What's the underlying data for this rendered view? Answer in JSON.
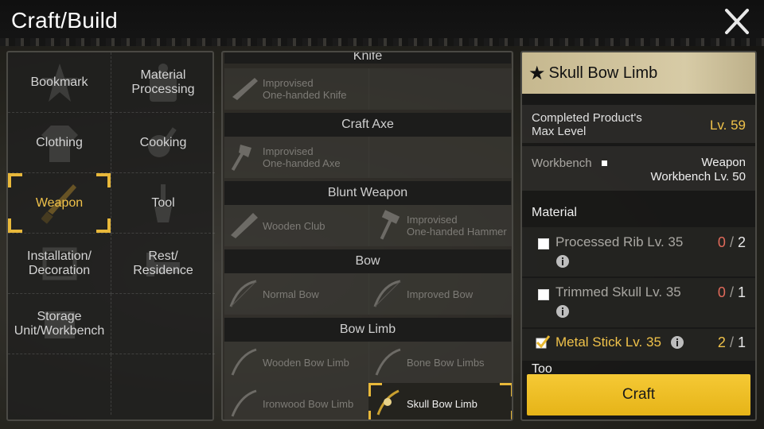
{
  "header": {
    "title": "Craft/Build",
    "close_icon": "close-icon"
  },
  "categories": [
    {
      "id": "bookmark",
      "label": "Bookmark",
      "icon": "star-icon"
    },
    {
      "id": "material-processing",
      "label": "Material\nProcessing",
      "icon": "furnace-icon"
    },
    {
      "id": "clothing",
      "label": "Clothing",
      "icon": "shirt-icon"
    },
    {
      "id": "cooking",
      "label": "Cooking",
      "icon": "pan-icon"
    },
    {
      "id": "weapon",
      "label": "Weapon",
      "icon": "knife-icon",
      "selected": true
    },
    {
      "id": "tool",
      "label": "Tool",
      "icon": "shovel-icon"
    },
    {
      "id": "installation",
      "label": "Installation/\nDecoration",
      "icon": "frame-icon"
    },
    {
      "id": "rest",
      "label": "Rest/\nResidence",
      "icon": "bed-icon"
    },
    {
      "id": "storage",
      "label": "Storage\nUnit/Workbench",
      "icon": "crate-icon"
    }
  ],
  "recipes": {
    "section_knife": "Knife",
    "improvised_knife": "Improvised\nOne-handed Knife",
    "section_axe": "Craft Axe",
    "improvised_axe": "Improvised\nOne-handed Axe",
    "section_blunt": "Blunt Weapon",
    "wooden_club": "Wooden Club",
    "improvised_hammer": "Improvised\nOne-handed Hammer",
    "section_bow": "Bow",
    "normal_bow": "Normal Bow",
    "improved_bow": "Improved Bow",
    "section_bow_limb": "Bow Limb",
    "wooden_bow_limb": "Wooden Bow Limb",
    "bone_bow_limbs": "Bone Bow Limbs",
    "ironwood_bow_limb": "Ironwood Bow Limb",
    "skull_bow_limb": "Skull Bow Limb"
  },
  "detail": {
    "item_name": "Skull Bow Limb",
    "max_level_label": "Completed Product's\nMax Level",
    "max_level_value": "Lv. 59",
    "workbench_label": "Workbench",
    "workbench_value": "Weapon\nWorkbench Lv. 50",
    "material_header": "Material",
    "materials": [
      {
        "name": "Processed Rib Lv. 35",
        "have": "0",
        "sep": "/",
        "need": "2",
        "met": false
      },
      {
        "name": "Trimmed Skull Lv. 35",
        "have": "0",
        "sep": "/",
        "need": "1",
        "met": false
      },
      {
        "name": "Metal Stick Lv. 35",
        "have": "2",
        "sep": "/",
        "need": "1",
        "met": true
      }
    ],
    "next_section_partial": "Too"
  },
  "actions": {
    "craft_label": "Craft"
  },
  "colors": {
    "accent": "#f0c24a",
    "craft_button": "#f0c12c",
    "shortage": "#e06a5a",
    "title_bar": "#d0c39e"
  }
}
